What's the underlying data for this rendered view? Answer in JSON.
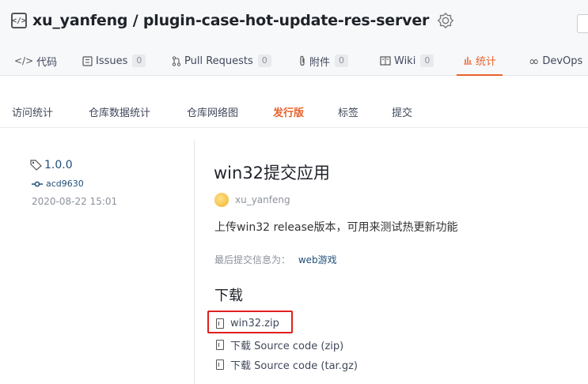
{
  "repo": {
    "title": "xu_yanfeng / plugin-case-hot-update-res-server",
    "icon": "repo-code-icon"
  },
  "tabs": [
    {
      "label": "代码",
      "icon": "code-icon"
    },
    {
      "label": "Issues",
      "count": "0",
      "icon": "issues-icon"
    },
    {
      "label": "Pull Requests",
      "count": "0",
      "icon": "pull-request-icon"
    },
    {
      "label": "附件",
      "count": "0",
      "icon": "paperclip-icon"
    },
    {
      "label": "Wiki",
      "count": "0",
      "icon": "book-icon"
    },
    {
      "label": "统计",
      "icon": "bar-chart-icon",
      "active": true
    },
    {
      "label": "DevOps",
      "icon": "infinity-icon"
    }
  ],
  "subnav": [
    {
      "label": "访问统计"
    },
    {
      "label": "仓库数据统计"
    },
    {
      "label": "仓库网络图"
    },
    {
      "label": "发行版",
      "active": true
    },
    {
      "label": "标签"
    },
    {
      "label": "提交"
    }
  ],
  "release": {
    "tag": "1.0.0",
    "commit": "acd9630",
    "date": "2020-08-22 15:01",
    "title": "win32提交应用",
    "author": "xu_yanfeng",
    "description": "上传win32 release版本，可用来测试热更新功能",
    "last_commit_label": "最后提交信息为：",
    "last_commit_link": "web游戏",
    "downloads_title": "下载",
    "assets": [
      {
        "label": "win32.zip"
      },
      {
        "label": "下载 Source code (zip)"
      },
      {
        "label": "下载 Source code (tar.gz)"
      }
    ]
  },
  "colors": {
    "accent": "#e8622c",
    "link": "#1f4e79",
    "highlight": "#e02020"
  }
}
